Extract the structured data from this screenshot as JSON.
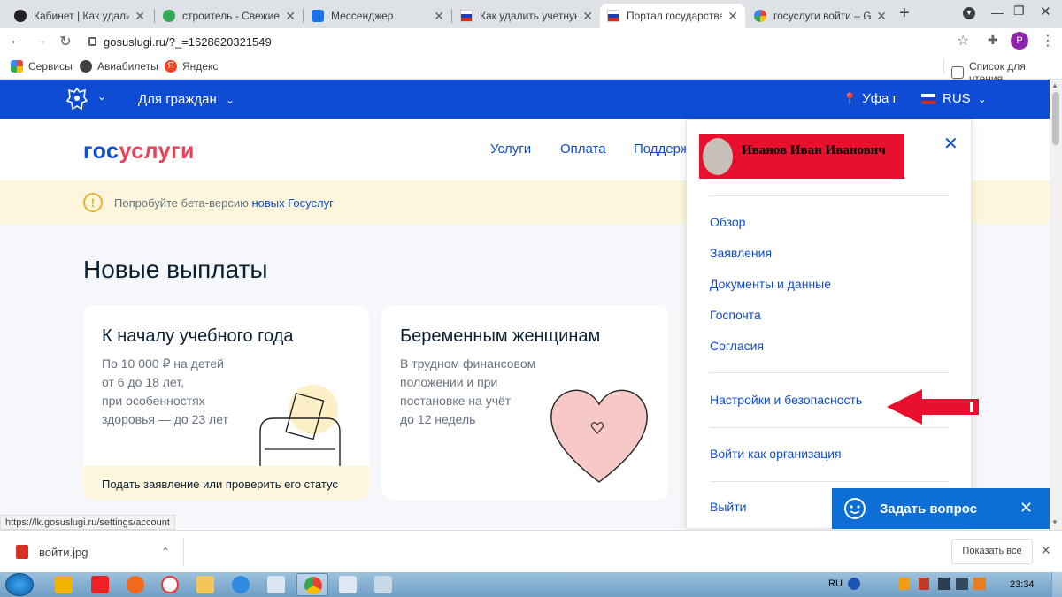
{
  "browser": {
    "tabs": [
      {
        "title": "Кабинет | Как удалить у",
        "icon": "tab-page-icon",
        "color": "#202124"
      },
      {
        "title": "строитель - Свежие ва",
        "icon": "tab-dots-icon",
        "color": "#34a853"
      },
      {
        "title": "Мессенджер",
        "icon": "tab-chat-icon",
        "color": "#1a73e8"
      },
      {
        "title": "Как удалить учетную з",
        "icon": "tab-flag-icon",
        "color": "#d52b1e"
      },
      {
        "title": "Портал государственн",
        "icon": "tab-flag-icon",
        "color": "#0d4cd3"
      },
      {
        "title": "госуслуги войти – Goo",
        "icon": "tab-google-icon",
        "color": "#4285f4"
      }
    ],
    "url": "gosuslugi.ru/?_=1628620321549",
    "profile_letter": "P",
    "bookmarks": [
      {
        "label": "Сервисы",
        "icon": "apps-icon"
      },
      {
        "label": "Авиабилеты",
        "icon": "globe-icon"
      },
      {
        "label": "Яндекс",
        "icon": "yandex-icon"
      }
    ],
    "reading_list": "Список для чтения",
    "status_url": "https://lk.gosuslugi.ru/settings/account",
    "download": {
      "file": "войти.jpg",
      "show_all": "Показать все"
    }
  },
  "site": {
    "for_whom": "Для граждан",
    "city": "Уфа г",
    "language": "RUS",
    "logo_a": "гос",
    "logo_b": "услуги",
    "nav": [
      "Услуги",
      "Оплата",
      "Поддерж"
    ],
    "beta_text": "Попробуйте бета-версию ",
    "beta_link": "новых Госуслуг",
    "heading": "Новые выплаты",
    "cards": [
      {
        "title": "К началу учебного года",
        "desc": [
          "По 10 000 ₽ на детей",
          "от 6 до 18 лет,",
          "при особенностях",
          "здоровья — до 23 лет"
        ],
        "footer": "Подать заявление или проверить его статус"
      },
      {
        "title": "Беременным женщинам",
        "desc": [
          "В трудном финансовом",
          "положении и при",
          "постановке на учёт",
          "до 12 недель"
        ],
        "footer": ""
      }
    ],
    "menu": {
      "user_name": "Иванов Иван  Иванович",
      "items": [
        "Обзор",
        "Заявления",
        "Документы и данные",
        "Госпочта",
        "Согласия"
      ],
      "settings": "Настройки и безопасность",
      "org": "Войти как организация",
      "logout": "Выйти"
    },
    "chat_label": "Задать вопрос",
    "colors": {
      "brand_blue": "#0d4cd3",
      "brand_red": "#ee3f58",
      "arrow": "#e8102c"
    }
  },
  "taskbar": {
    "lang": "RU",
    "time": "23:34"
  }
}
